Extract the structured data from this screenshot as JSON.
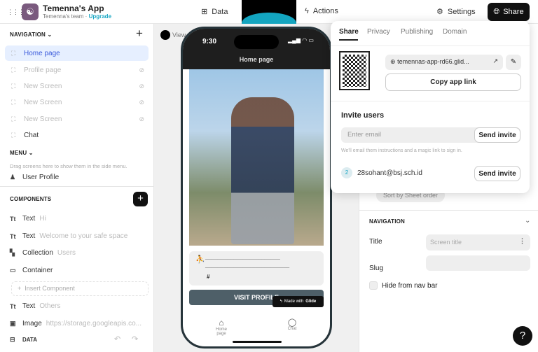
{
  "header": {
    "app_title": "Temenna's App",
    "team": "Temenna's team",
    "separator": " · ",
    "upgrade": "Upgrade",
    "tabs": {
      "data": "Data",
      "actions": "Actions",
      "settings": "Settings"
    },
    "share": "Share"
  },
  "sidebar": {
    "navigation_heading": "NAVIGATION",
    "nav_items": [
      {
        "label": "Home page"
      },
      {
        "label": "Profile page"
      },
      {
        "label": "New Screen"
      },
      {
        "label": "New Screen"
      },
      {
        "label": "New Screen"
      },
      {
        "label": "Chat"
      }
    ],
    "menu_heading": "MENU",
    "menu_hint": "Drag screens here to show them in the side menu.",
    "menu_item": "User Profile",
    "components_heading": "COMPONENTS",
    "components": [
      {
        "type": "Text",
        "value": "Hi"
      },
      {
        "type": "Text",
        "value": "Welcome to your safe space"
      },
      {
        "type": "Collection",
        "value": "Users"
      },
      {
        "type": "Container",
        "value": ""
      }
    ],
    "insert_component": "Insert Component",
    "components_after": [
      {
        "type": "Text",
        "value": "Others"
      },
      {
        "type": "Image",
        "value": "https://storage.googleapis.co..."
      }
    ],
    "data_label": "DATA"
  },
  "canvas": {
    "view_label": "View"
  },
  "phone": {
    "time": "9:30",
    "title": "Home page",
    "profile_line1": "________________________",
    "profile_line2": "___________________________",
    "profile_hash": "#",
    "visit_button": "VISIT PROFILE",
    "made_with": "Made with",
    "glide": "Glide",
    "tabs": [
      {
        "label": "Home page"
      },
      {
        "label": "Chat"
      }
    ]
  },
  "share_popup": {
    "tabs": [
      "Share",
      "Privacy",
      "Publishing",
      "Domain"
    ],
    "app_url": "temennas-app-rd66.glid...",
    "copy_link": "Copy app link",
    "invite_heading": "Invite users",
    "email_placeholder": "Enter email",
    "send_invite": "Send invite",
    "hint": "We'll email them instructions and a magic link to sign in.",
    "invited": [
      {
        "avatar": "2",
        "email": "28sohant@bsj.sch.id",
        "action": "Send invite"
      }
    ]
  },
  "right_panel": {
    "sort": "Sort by Sheet order",
    "navigation_heading": "NAVIGATION",
    "title_label": "Title",
    "title_placeholder": "Screen title",
    "slug_label": "Slug",
    "hide_nav": "Hide from nav bar"
  },
  "help": "?"
}
